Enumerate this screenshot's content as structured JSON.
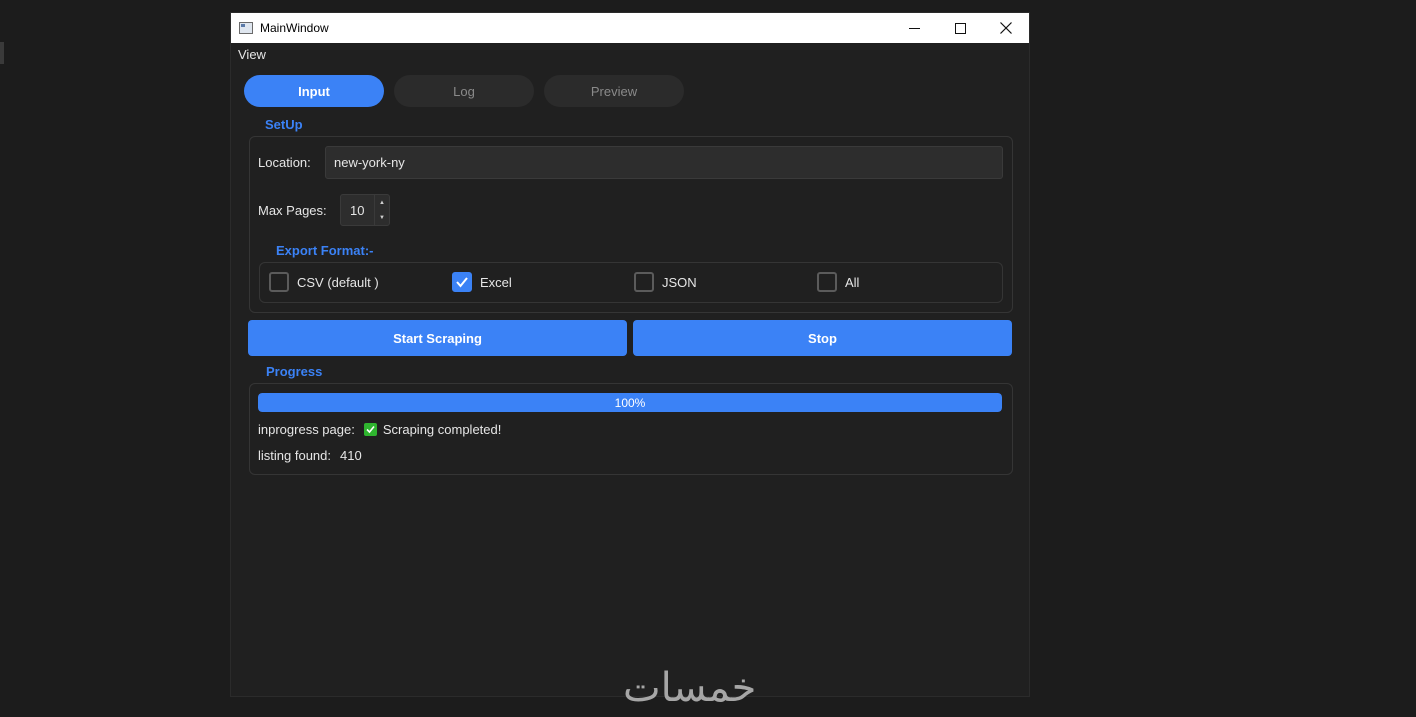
{
  "window": {
    "title": "MainWindow"
  },
  "titlebar_buttons": {
    "minimize": "—",
    "maximize": "☐",
    "close": "✕"
  },
  "menu": {
    "view": "View"
  },
  "tabs": [
    {
      "label": "Input",
      "active": true
    },
    {
      "label": "Log",
      "active": false
    },
    {
      "label": "Preview",
      "active": false
    }
  ],
  "setup": {
    "title": "SetUp",
    "location_label": "Location:",
    "location_value": "new-york-ny",
    "max_pages_label": "Max Pages:",
    "max_pages_value": "10"
  },
  "export": {
    "title": "Export Format:-",
    "options": [
      {
        "label": "CSV (default )",
        "checked": false
      },
      {
        "label": "Excel",
        "checked": true
      },
      {
        "label": "JSON",
        "checked": false
      },
      {
        "label": "All",
        "checked": false
      }
    ]
  },
  "actions": {
    "start_label": "Start Scraping",
    "stop_label": "Stop"
  },
  "progress": {
    "title": "Progress",
    "value_text": "100%",
    "value": 100,
    "inprogress_label": "inprogress page:",
    "status_text": "Scraping completed!",
    "listing_label": "listing found:",
    "listing_count": "410"
  },
  "watermark": "خمسات",
  "colors": {
    "accent": "#3b82f6",
    "window_bg": "#202020",
    "success": "#2fb52f"
  }
}
